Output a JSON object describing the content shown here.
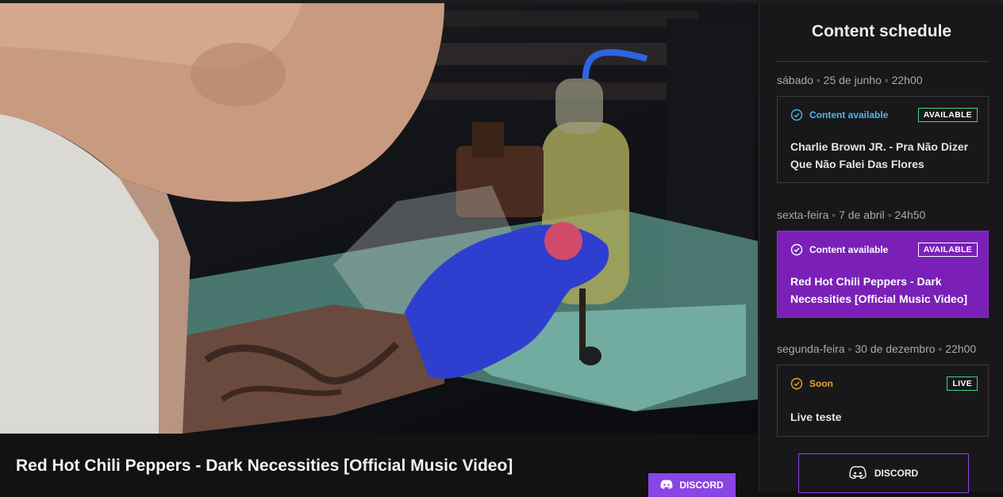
{
  "video": {
    "title": "Red Hot Chili Peppers - Dark Necessities [Official Music Video]"
  },
  "actions": {
    "discord_label": "DISCORD"
  },
  "sidebar": {
    "title": "Content schedule",
    "items": [
      {
        "date": "sábado ◦ 25 de junho ◦ 22h00",
        "status": "Content available",
        "status_icon": "check-circle-icon",
        "status_color": "#4fb8e8",
        "badge": "AVAILABLE",
        "badge_color": "#3fd67a",
        "title": "Charlie Brown JR. - Pra Não Dizer Que Não Falei Das Flores",
        "active": false
      },
      {
        "date": "sexta-feira ◦ 7 de abril ◦ 24h50",
        "status": "Content available",
        "status_icon": "check-circle-icon",
        "status_color": "#ffffff",
        "badge": "AVAILABLE",
        "badge_color": "#ffffff",
        "title": "Red Hot Chili Peppers - Dark Necessities [Official Music Video]",
        "active": true,
        "active_color": "#7a20b8"
      },
      {
        "date": "segunda-feira ◦ 30 de dezembro ◦ 22h00",
        "status": "Soon",
        "status_icon": "clock-check-icon",
        "status_color": "#f0a030",
        "badge": "LIVE",
        "badge_color": "#3fd67a",
        "title": "Live teste",
        "active": false
      }
    ]
  }
}
